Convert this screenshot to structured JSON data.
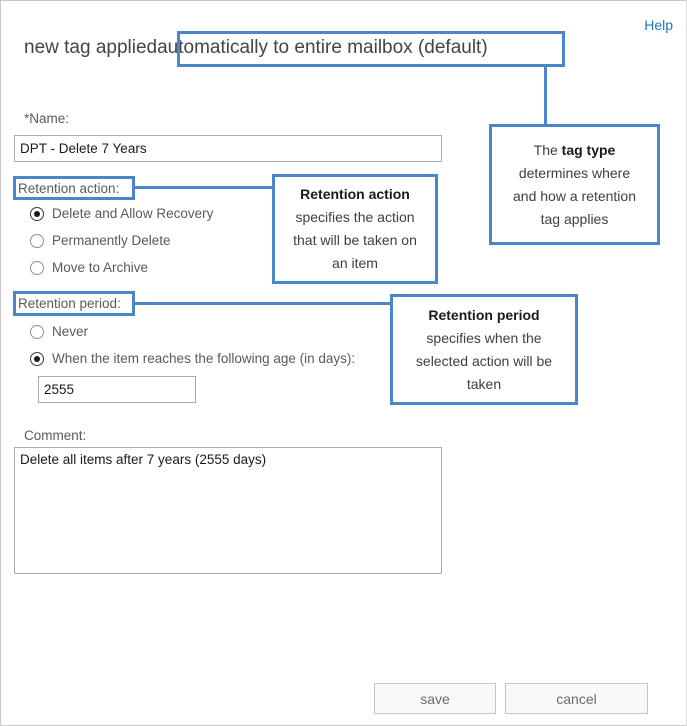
{
  "window": {
    "help_label": "Help"
  },
  "title": {
    "prefix": "new tag applied ",
    "highlighted": "automatically to entire mailbox (default)"
  },
  "form": {
    "name_label": "*Name:",
    "name_value": "DPT - Delete 7 Years",
    "name_placeholder": "",
    "retention_action_label": "Retention action:",
    "retention_action_options": [
      {
        "label": "Delete and Allow Recovery",
        "selected": true
      },
      {
        "label": "Permanently Delete",
        "selected": false
      },
      {
        "label": "Move to Archive",
        "selected": false
      }
    ],
    "retention_period_label": "Retention period:",
    "retention_period_options": [
      {
        "label": "Never",
        "selected": false
      },
      {
        "label": "When the item reaches the following age (in days):",
        "selected": true
      }
    ],
    "age_days_value": "2555",
    "age_days_placeholder": "",
    "comment_label": "Comment:",
    "comment_value": "Delete all items after 7 years (2555 days)",
    "comment_placeholder": ""
  },
  "callouts": {
    "tag_type": {
      "line1_normal": "The ",
      "line1_bold": "tag type",
      "line2": "determines where",
      "line3": "and how a retention",
      "line4": "tag applies"
    },
    "retention_action": {
      "line1_bold": "Retention action",
      "line2": "specifies the action",
      "line3": "that will be taken on",
      "line4": "an item"
    },
    "retention_period": {
      "line1_bold": "Retention period",
      "line2": "specifies when the",
      "line3": "selected action will be",
      "line4": "taken"
    }
  },
  "footer": {
    "save_label": "save",
    "cancel_label": "cancel"
  },
  "colors": {
    "annotation": "#4a86c8",
    "link": "#1a78c2",
    "text": "#5a5a5a"
  }
}
